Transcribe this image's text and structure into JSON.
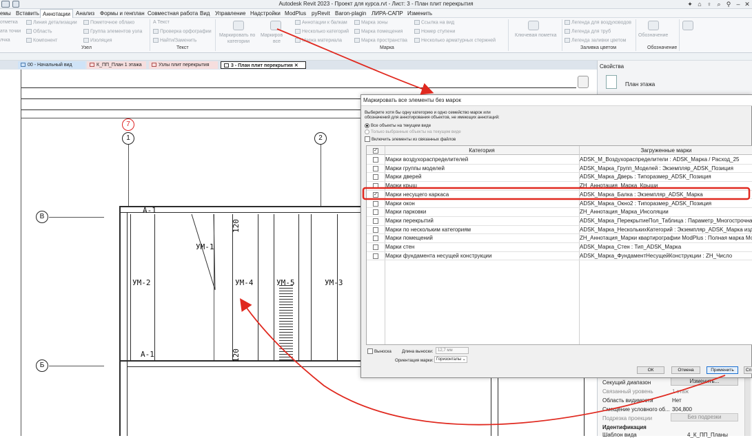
{
  "titlebar": {
    "title": "Autodesk Revit 2023 - Проект для курса.rvt - Лист: 3 - План плит перекрытия",
    "controls": [
      "✦",
      "⌂",
      "♀",
      "⌕",
      "⚲",
      "–",
      "✕"
    ]
  },
  "menubar": {
    "tabs": [
      "емы",
      "Вставить",
      "Аннотации",
      "Анализ",
      "Формы и генплан",
      "Совместная работа",
      "Вид",
      "Управление",
      "Надстройки",
      "ModPlus",
      "pyRevit",
      "Baron-plagin",
      "ЛИРА-САПР",
      "Изменить"
    ]
  },
  "ribbon": {
    "col1": [
      "отметка",
      "ата точки",
      "лчка"
    ],
    "col2": [
      "Линия детализации",
      "Область",
      "Компонент"
    ],
    "col3": [
      "Пометочное облако",
      "Группа элементов узла",
      "Изоляция"
    ],
    "col4": [
      "A  Текст",
      "Проверка орфографии",
      "Найти/Заменить"
    ],
    "tag_btn1": [
      "Маркировать по",
      "категории"
    ],
    "tag_btn2": [
      "Маркиров",
      "все"
    ],
    "col5": [
      "Аннотации к балкам",
      "Несколько категорий",
      "Марка материала"
    ],
    "col6": [
      "Марка зоны",
      "Марка помещения",
      "Марка пространства"
    ],
    "col7": [
      "Ссылка на вид",
      "Номер ступени",
      "Несколько арматурных стержней"
    ],
    "key_tag": [
      "Ключевая пометка"
    ],
    "col8": [
      "Легенда для воздуховодов",
      "Легенда для труб",
      "Легенда заливки цветом"
    ],
    "designation": [
      "Обозначение"
    ],
    "panels": [
      "Узел",
      "Текст",
      "Марка",
      "Заливка цветом",
      "Обозначение"
    ]
  },
  "viewtabs": [
    {
      "label": "00 - Начальный вид"
    },
    {
      "label": "К_ПП_План 1 этажа"
    },
    {
      "label": "Узлы плит перекрытия"
    },
    {
      "label": "3 - План плит перекрытия"
    }
  ],
  "viewtab_close": "✕",
  "drawing": {
    "grid_bubbles": [
      "1",
      "2",
      "В",
      "Б"
    ],
    "red_bubble": "7",
    "labels": [
      "УМ-1",
      "УМ-2",
      "УМ-4",
      "УМ-5",
      "УМ-3",
      "А-1",
      "А-1",
      "120",
      "120"
    ]
  },
  "properties": {
    "header": "Свойства",
    "type": "План этажа",
    "rows": [
      {
        "name": "Секущий диапазон",
        "value": "Изменить..."
      },
      {
        "name": "Связанный уровень",
        "value": "1 этаж"
      },
      {
        "name": "Область видимости",
        "value": "Нет"
      },
      {
        "name": "Смещение условного об...",
        "value": "304,800"
      },
      {
        "name": "Подрезка проекции",
        "value": "Без подрезки"
      }
    ],
    "section": "Идентификация",
    "last_row": {
      "name": "Шаблон вида",
      "value": "4_К_ПП_Планы"
    }
  },
  "dialog": {
    "title": "Маркировать все элементы без марок",
    "instructions": [
      "Выберите хотя бы одну категорию и одно семейство марок или",
      "обозначений для аннотирования объектов, не имеющих аннотаций:"
    ],
    "radio1": "Все объекты на текущем виде",
    "radio2": "Только выбранные объекты на текущем виде",
    "include_linked": "Включить элементы из связанных файлов",
    "col_category": "Категория",
    "col_loaded": "Загруженные марки",
    "rows": [
      {
        "category": "Марки воздухораспределителей",
        "tag": "ADSK_M_Воздухораспределители : ADSK_Марка / Расход_25",
        "checked": false
      },
      {
        "category": "Марки группы моделей",
        "tag": "ADSK_Марка_Групп_Моделей : Экземпляр_ADSK_Позиция",
        "checked": false
      },
      {
        "category": "Марки дверей",
        "tag": "ADSK_Марка_Дверь : Типоразмер_ADSK_Позиция",
        "checked": false
      },
      {
        "category": "Марки крыш",
        "tag": "ZH_Аннотация_Марка_Крыши",
        "checked": false
      },
      {
        "category": "Марки несущего каркаса",
        "tag": "ADSK_Марка_Балка : Экземпляр_ADSK_Марка",
        "checked": true
      },
      {
        "category": "Марки окон",
        "tag": "ADSK_Марка_Окно2 : Типоразмер_ADSK_Позиция",
        "checked": false
      },
      {
        "category": "Марки парковки",
        "tag": "ZH_Аннотация_Марка_Инсоляции",
        "checked": false
      },
      {
        "category": "Марки перекрытий",
        "tag": "ADSK_Марка_ПерекрытиеПол_Таблица : Параметр_Многострочная_С",
        "checked": false
      },
      {
        "category": "Марки по нескольким категориям",
        "tag": "ADSK_Марка_НесколькихКатегорий : Экземпляр_ADSK_Марка издел",
        "checked": false
      },
      {
        "category": "Марки помещений",
        "tag": "ZH_Аннотация_Марки квартирографии ModPlus : Полная марка Мос",
        "checked": false
      },
      {
        "category": "Марки стен",
        "tag": "ADSK_Марка_Стен : Тип_ADSK_Марка",
        "checked": false
      },
      {
        "category": "Марки фундамента несущей конструкции",
        "tag": "ADSK_Марка_ФундаментНесущейКонструкции : ZH_Число",
        "checked": false
      }
    ],
    "leader_label": "Выноска",
    "leader_length_label": "Длина выноски:",
    "leader_length_value": "12,7 мм",
    "orientation_label": "Ориентация марки:",
    "orientation_value": "Горизонталы",
    "ok": "ОК",
    "cancel": "Отмена",
    "apply": "Применить",
    "help": "Сп"
  },
  "colors": {
    "highlight": "#e0291f",
    "accent": "#1a6fd1"
  }
}
